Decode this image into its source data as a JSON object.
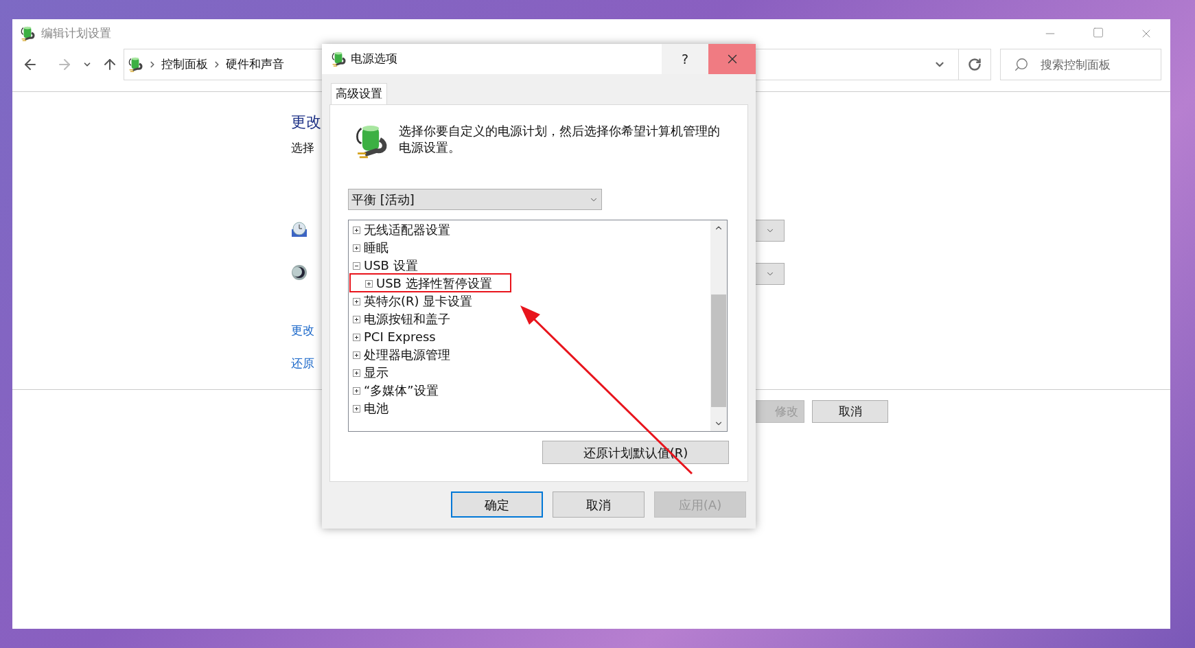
{
  "main_window": {
    "title": "编辑计划设置",
    "breadcrumb": [
      "控制面板",
      "硬件和声音"
    ],
    "search": {
      "placeholder": "搜索控制面板"
    },
    "heading": "更改",
    "subtitle": "选择",
    "links": [
      "更改",
      "还原"
    ],
    "buttons": [
      {
        "label": "修改",
        "disabled": true
      },
      {
        "label": "取消",
        "disabled": false
      }
    ]
  },
  "dialog": {
    "title": "电源选项",
    "help": "?",
    "tabs": [
      {
        "label": "高级设置",
        "selected": true
      }
    ],
    "description": "选择你要自定义的电源计划，然后选择你希望计算机管理的电源设置。",
    "plan_select": {
      "value": "平衡 [活动]"
    },
    "tree": [
      {
        "label": "无线适配器设置",
        "expanded": false
      },
      {
        "label": "睡眠",
        "expanded": false
      },
      {
        "label": "USB 设置",
        "expanded": true,
        "children": [
          {
            "label": "USB 选择性暂停设置",
            "expanded": false
          }
        ]
      },
      {
        "label": "英特尔(R) 显卡设置",
        "expanded": false
      },
      {
        "label": "电源按钮和盖子",
        "expanded": false
      },
      {
        "label": "PCI Express",
        "expanded": false
      },
      {
        "label": "处理器电源管理",
        "expanded": false
      },
      {
        "label": "显示",
        "expanded": false
      },
      {
        "label": "“多媒体”设置",
        "expanded": false
      },
      {
        "label": "电池",
        "expanded": false
      }
    ],
    "restore_button": "还原计划默认值(R)",
    "buttons": [
      {
        "label": "确定",
        "default": true,
        "disabled": false
      },
      {
        "label": "取消",
        "default": false,
        "disabled": false
      },
      {
        "label": "应用(A)",
        "default": false,
        "disabled": true
      }
    ]
  }
}
